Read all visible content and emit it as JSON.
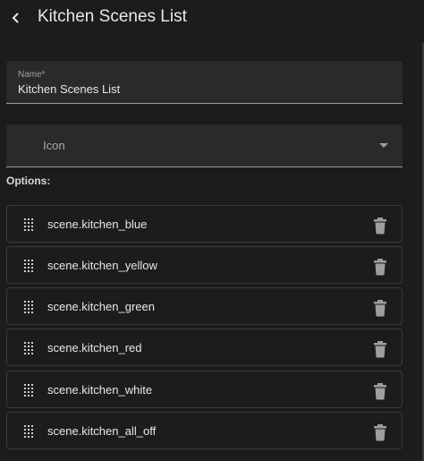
{
  "header": {
    "title": "Kitchen Scenes List",
    "back_icon": "chevron-left-icon"
  },
  "name_field": {
    "label": "Name*",
    "value": "Kitchen Scenes List"
  },
  "icon_field": {
    "placeholder": "Icon",
    "dropdown_icon": "caret-down-icon"
  },
  "options_label": "Options:",
  "options": [
    {
      "label": "scene.kitchen_blue"
    },
    {
      "label": "scene.kitchen_yellow"
    },
    {
      "label": "scene.kitchen_green"
    },
    {
      "label": "scene.kitchen_red"
    },
    {
      "label": "scene.kitchen_white"
    },
    {
      "label": "scene.kitchen_all_off"
    }
  ],
  "colors": {
    "background": "#1c1c1c",
    "field_background": "#2a2a2a",
    "border": "#3a3a3a",
    "text": "#e8e8e8",
    "muted_text": "#a0a0a0",
    "icon": "#9e9e9e"
  }
}
